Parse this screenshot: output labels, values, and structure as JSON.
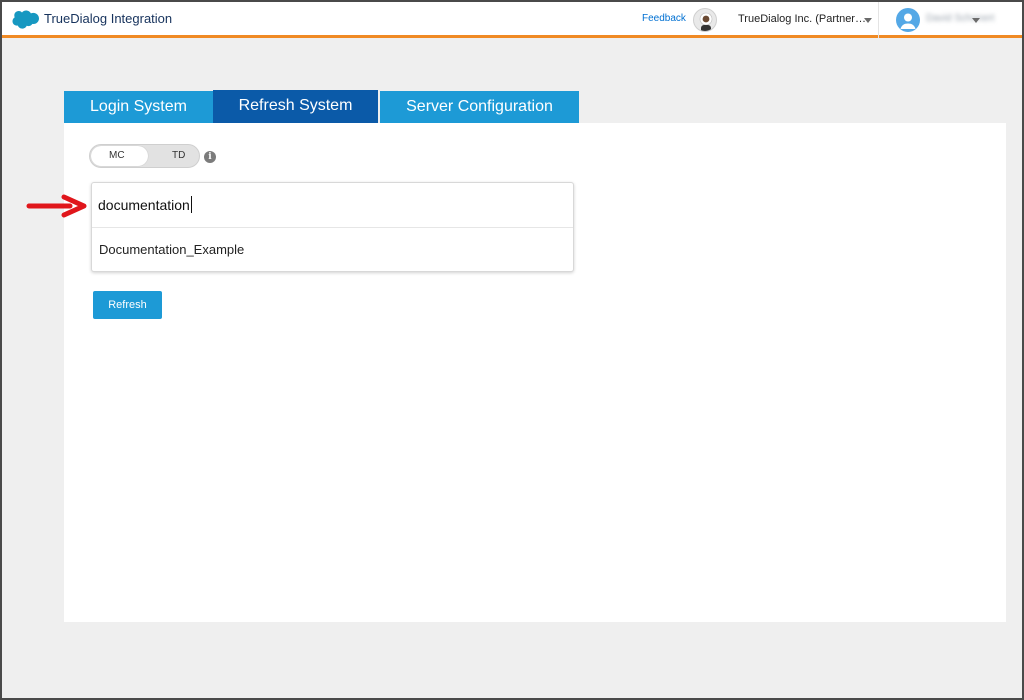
{
  "header": {
    "app_title": "TrueDialog Integration",
    "feedback_label": "Feedback",
    "org_name": "TrueDialog Inc. (Partner…",
    "user_name": "David Schonert"
  },
  "tabs": [
    {
      "label": "Login System",
      "active": false
    },
    {
      "label": "Refresh System",
      "active": true
    },
    {
      "label": "Server Configuration",
      "active": false
    }
  ],
  "toggle": {
    "left_label": "MC",
    "right_label": "TD",
    "selected": "MC"
  },
  "search": {
    "value": "documentation",
    "suggestions": [
      "Documentation_Example"
    ]
  },
  "actions": {
    "refresh_label": "Refresh"
  },
  "colors": {
    "accent": "#1d9ad6",
    "active_tab": "#0b5aa8",
    "header_border": "#f08a24",
    "annotation_arrow": "#e0161b"
  },
  "icons": {
    "logo": "salesforce-cloud-icon",
    "info": "info-icon",
    "astro": "astro-avatar-icon",
    "user": "user-avatar-icon"
  }
}
